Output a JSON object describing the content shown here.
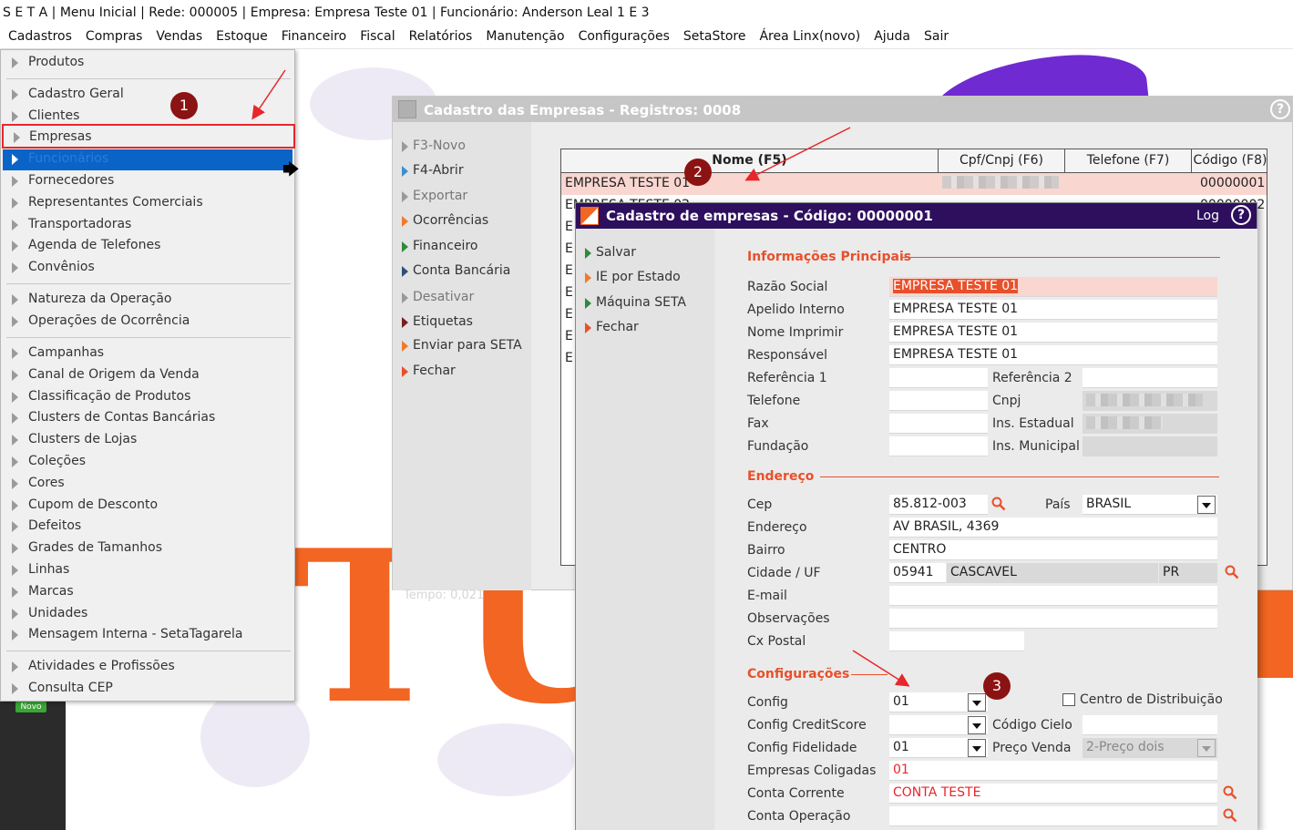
{
  "title_bar": "S E T A | Menu Inicial | Rede: 000005 | Empresa: Empresa Teste  01 | Funcionário: Anderson Leal 1 E 3",
  "menubar": [
    "Cadastros",
    "Compras",
    "Vendas",
    "Estoque",
    "Financeiro",
    "Fiscal",
    "Relatórios",
    "Manutenção",
    "Configurações",
    "SetaStore",
    "Área Linx(novo)",
    "Ajuda",
    "Sair"
  ],
  "dropdown": {
    "groups": [
      [
        "Produtos"
      ],
      [
        "Cadastro Geral",
        "Clientes",
        "Empresas",
        "Funcionários",
        "Fornecedores",
        "Representantes Comerciais",
        "Transportadoras",
        "Agenda de Telefones",
        "Convênios"
      ],
      [
        "Natureza da Operação",
        "Operações de Ocorrência"
      ],
      [
        "Campanhas",
        "Canal de Origem da Venda",
        "Classificação de Produtos",
        "Clusters de Contas Bancárias",
        "Clusters de Lojas",
        "Coleções",
        "Cores",
        "Cupom de Desconto",
        "Defeitos",
        "Grades de Tamanhos",
        "Linhas",
        "Marcas",
        "Unidades",
        "Mensagem Interna - SetaTagarela"
      ],
      [
        "Atividades e Profissões",
        "Consulta CEP"
      ]
    ]
  },
  "novo_badge": "Novo",
  "badges": [
    "1",
    "2",
    "3"
  ],
  "colors": {
    "accent": "#e8502b",
    "select_blue": "#0a64c8",
    "title_purple": "#2d0f5e",
    "badge": "#8c1313",
    "arrow": "#e8262b"
  },
  "win1": {
    "title": "Cadastro das Empresas - Registros: 0008",
    "side": [
      "F3-Novo",
      "F4-Abrir",
      "Exportar",
      "Ocorrências",
      "Financeiro",
      "Conta Bancária",
      "Desativar",
      "Etiquetas",
      "Enviar para SETA",
      "Fechar"
    ],
    "tempo": "Tempo:  0,021",
    "columns": [
      "Nome (F5)",
      "Cpf/Cnpj (F6)",
      "Telefone (F7)",
      "Código (F8)"
    ],
    "rows": [
      {
        "nome": "EMPRESA TESTE 01",
        "codigo": "00000001"
      },
      {
        "nome": "EMPRESA TESTE 02",
        "codigo": "00000002"
      }
    ],
    "row_stubs": [
      "E",
      "E",
      "E",
      "E",
      "E",
      "E",
      "E"
    ]
  },
  "win2": {
    "title": "Cadastro de empresas - Código: 00000001",
    "log": "Log",
    "side": [
      "Salvar",
      "IE por Estado",
      "Máquina SETA",
      "Fechar"
    ],
    "sections": {
      "principais": "Informações Principais",
      "endereco": "Endereço",
      "config": "Configurações"
    },
    "labels": {
      "razao": "Razão Social",
      "apelido": "Apelido Interno",
      "nome_imprimir": "Nome Imprimir",
      "responsavel": "Responsável",
      "ref1": "Referência 1",
      "ref2": "Referência 2",
      "telefone": "Telefone",
      "cnpj": "Cnpj",
      "fax": "Fax",
      "ins_estadual": "Ins. Estadual",
      "fundacao": "Fundação",
      "ins_municipal": "Ins. Municipal",
      "cep": "Cep",
      "pais": "País",
      "endereco": "Endereço",
      "bairro": "Bairro",
      "cidade_uf": "Cidade / UF",
      "email": "E-mail",
      "observacoes": "Observações",
      "cx_postal": "Cx Postal",
      "config": "Config",
      "centro_dist": "Centro de Distribuição",
      "config_credit": "Config CreditScore",
      "codigo_cielo": "Código Cielo",
      "config_fidel": "Config Fidelidade",
      "preco_venda": "Preço Venda",
      "coligadas": "Empresas Coligadas",
      "conta_corrente": "Conta Corrente",
      "conta_operacao": "Conta Operação"
    },
    "values": {
      "razao": "EMPRESA TESTE 01",
      "apelido": "EMPRESA TESTE  01",
      "nome_imprimir": "EMPRESA TESTE 01",
      "responsavel": "EMPRESA TESTE  01",
      "cep": "85.812-003",
      "pais": "BRASIL",
      "endereco": "AV BRASIL, 4369",
      "bairro": "CENTRO",
      "cidade_cod": "05941",
      "cidade": "CASCAVEL",
      "uf": "PR",
      "config": "01",
      "config_fidel": "01",
      "preco_venda": "2-Preço dois",
      "coligadas": "01",
      "conta_corrente": "CONTA TESTE"
    }
  }
}
